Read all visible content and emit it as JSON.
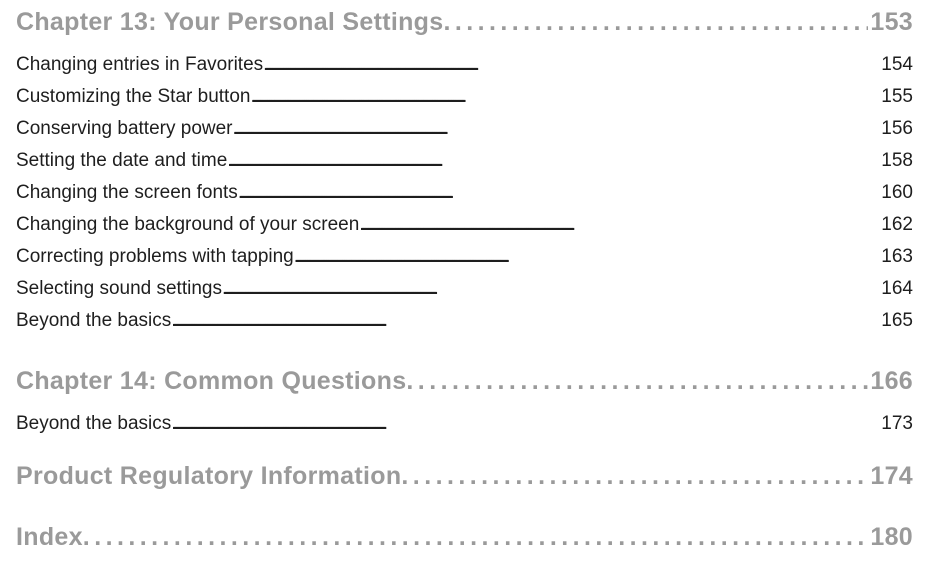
{
  "sections": [
    {
      "title": "Chapter 13:  Your Personal Settings",
      "page": "153",
      "entries": [
        {
          "label": "Changing entries in Favorites",
          "page": "154"
        },
        {
          "label": "Customizing the Star button",
          "page": "155"
        },
        {
          "label": "Conserving battery power",
          "page": "156"
        },
        {
          "label": "Setting the date and time",
          "page": "158"
        },
        {
          "label": "Changing the screen fonts",
          "page": "160"
        },
        {
          "label": "Changing the background of your screen",
          "page": "162"
        },
        {
          "label": "Correcting problems with tapping",
          "page": "163"
        },
        {
          "label": "Selecting sound settings",
          "page": "164"
        },
        {
          "label": "Beyond the basics",
          "page": "165"
        }
      ]
    },
    {
      "title": "Chapter 14:  Common Questions",
      "page": "166",
      "entries": [
        {
          "label": "Beyond the basics",
          "page": "173"
        }
      ]
    },
    {
      "title": "Product Regulatory Information",
      "page": "174",
      "entries": []
    },
    {
      "title": "Index",
      "page": "180",
      "entries": []
    }
  ]
}
